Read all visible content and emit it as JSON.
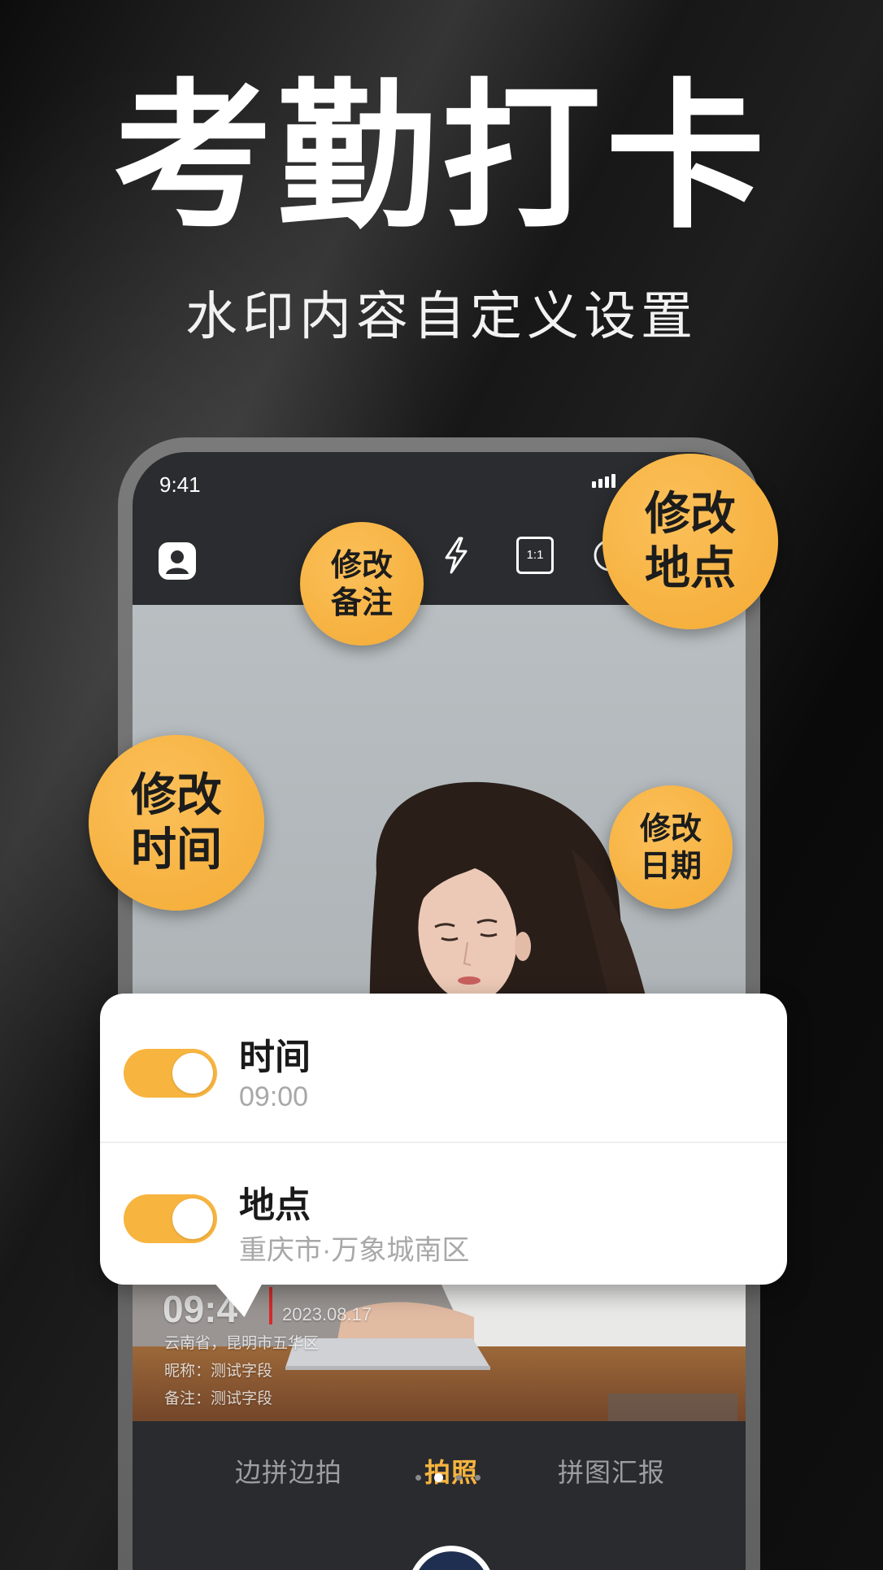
{
  "hero": {
    "title": "考勤打卡",
    "subtitle": "水印内容自定义设置"
  },
  "phone": {
    "status_bar": {
      "time": "9:41",
      "signal_icon": "signal-bars-icon"
    },
    "toolbar": {
      "avatar_icon": "avatar-icon",
      "flash_icon": "flash-icon",
      "ratio_label": "1:1",
      "camera_icon": "camera-switch-icon"
    },
    "watermark": {
      "time": "09:4",
      "date": "2023.08.17",
      "location": "云南省，昆明市五华区",
      "nickname": "昵称：测试字段",
      "note": "备注：测试字段"
    },
    "bottom_tabs": [
      {
        "label": "边拼边拍",
        "active": false
      },
      {
        "label": "拍照",
        "active": true
      },
      {
        "label": "拼图汇报",
        "active": false
      }
    ],
    "page_indicator": {
      "count": 4,
      "active_index": 1
    },
    "shutter_icon": "shutter-button-icon"
  },
  "callouts": [
    {
      "line1": "修改",
      "line2": "备注"
    },
    {
      "line1": "修改",
      "line2": "地点"
    },
    {
      "line1": "修改",
      "line2": "时间"
    },
    {
      "line1": "修改",
      "line2": "日期"
    }
  ],
  "settings_card": {
    "rows": [
      {
        "label": "时间",
        "value": "09:00",
        "enabled": true
      },
      {
        "label": "地点",
        "value": "重庆市·万象城南区",
        "enabled": true
      }
    ]
  },
  "colors": {
    "accent": "#f7b43f",
    "tab_inactive": "#9b9ea3",
    "watermark_bar": "#d62b2b",
    "card": "#ffffff",
    "background": "#0e0e0e"
  }
}
